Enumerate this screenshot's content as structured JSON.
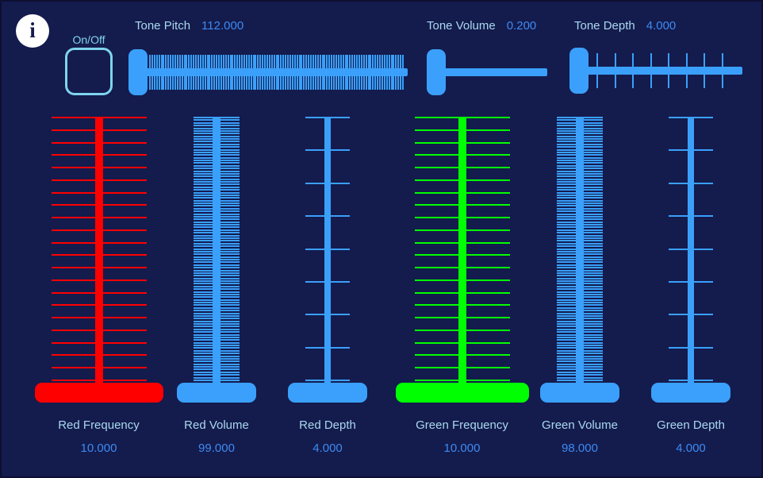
{
  "background_color": "#141b4d",
  "accent_color": "#3aa0fb",
  "label_color": "#a9d9ee",
  "value_color": "#3d8bf2",
  "info": {
    "icon": "info-circle-icon",
    "glyph": "i"
  },
  "toggle": {
    "label": "On/Off",
    "state": "off"
  },
  "horizontal_sliders": [
    {
      "name": "Tone Pitch",
      "value": "112.000",
      "value_number": 112.0,
      "ticks": 112,
      "color": "#3aa0fb",
      "handle_position": "left"
    },
    {
      "name": "Tone Volume",
      "value": "0.200",
      "value_number": 0.2,
      "ticks": 0,
      "color": "#3aa0fb",
      "handle_position": "left"
    },
    {
      "name": "Tone Depth",
      "value": "4.000",
      "value_number": 4.0,
      "ticks": 9,
      "color": "#3aa0fb",
      "handle_position": "left"
    }
  ],
  "vertical_sliders": [
    {
      "name": "Red Frequency",
      "value": "10.000",
      "value_number": 10.0,
      "ticks": 22,
      "color": "#ff0000",
      "handle_position": "bottom"
    },
    {
      "name": "Red Volume",
      "value": "99.000",
      "value_number": 99.0,
      "ticks": 99,
      "color": "#3aa0fb",
      "handle_position": "bottom"
    },
    {
      "name": "Red Depth",
      "value": "4.000",
      "value_number": 4.0,
      "ticks": 9,
      "color": "#3aa0fb",
      "handle_position": "bottom"
    },
    {
      "name": "Green Frequency",
      "value": "10.000",
      "value_number": 10.0,
      "ticks": 22,
      "color": "#00ff00",
      "handle_position": "bottom"
    },
    {
      "name": "Green Volume",
      "value": "98.000",
      "value_number": 98.0,
      "ticks": 99,
      "color": "#3aa0fb",
      "handle_position": "bottom"
    },
    {
      "name": "Green Depth",
      "value": "4.000",
      "value_number": 4.0,
      "ticks": 9,
      "color": "#3aa0fb",
      "handle_position": "bottom"
    }
  ]
}
